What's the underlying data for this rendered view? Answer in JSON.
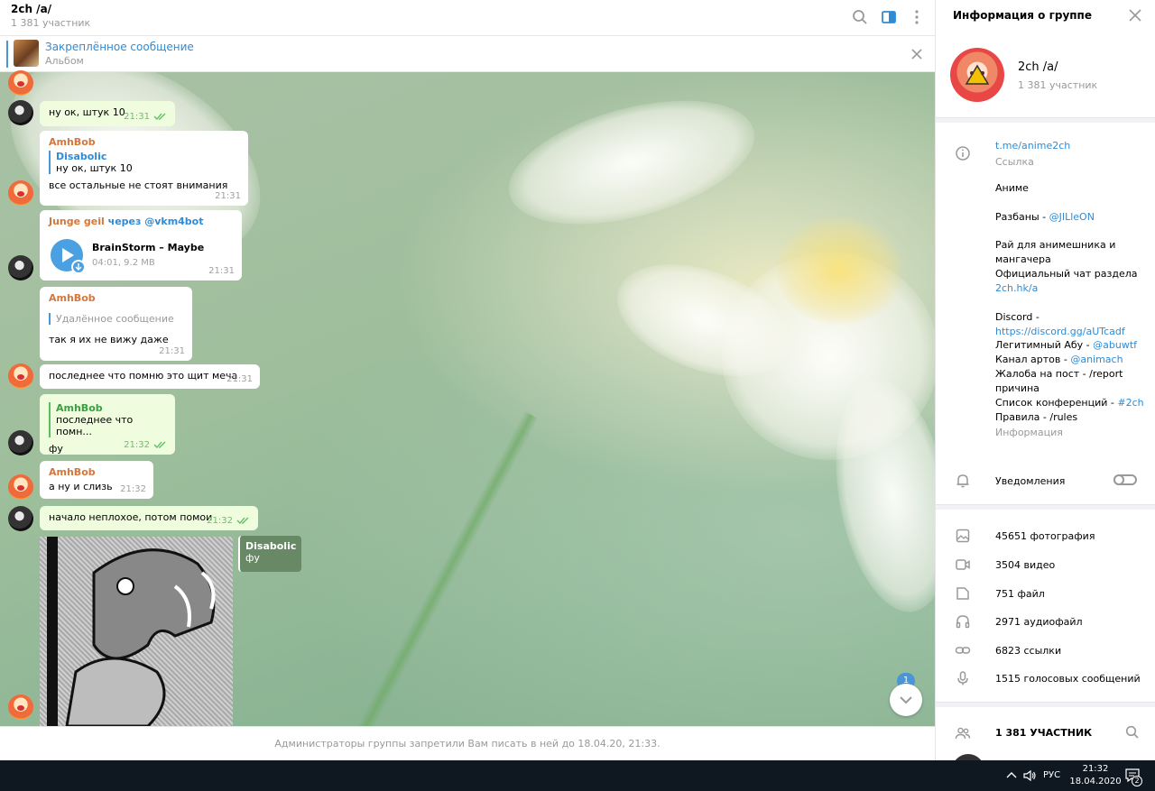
{
  "chat": {
    "title": "2ch /a/",
    "subtitle": "1 381 участник",
    "pinned_title": "Закреплённое сообщение",
    "pinned_subtitle": "Альбом",
    "composer_notice": "Администраторы группы запретили Вам писать в ней до 18.04.20, 21:33.",
    "unread_count": "1"
  },
  "messages": {
    "m1": {
      "text": "ну ок, штук 10",
      "time": "21:31"
    },
    "m2": {
      "sender": "AmhBob",
      "quote_name": "Disabolic",
      "quote_text": "ну ок, штук 10",
      "text": "все остальные не стоят внимания",
      "time": "21:31"
    },
    "m3": {
      "sender": "Junge geil",
      "via": "через @vkm4bot",
      "track": "BrainStorm – Maybe",
      "meta": "04:01, 9.2 MB",
      "time": "21:31"
    },
    "m4": {
      "sender": "AmhBob",
      "quote_text": "Удалённое сообщение",
      "text": "так я их не вижу даже",
      "time": "21:31"
    },
    "m5": {
      "text": "последнее что помню это щит меча",
      "time": "21:31"
    },
    "m6": {
      "quote_name": "AmhBob",
      "quote_text": "последнее что помн...",
      "text": "фу",
      "time": "21:32"
    },
    "m7": {
      "sender": "AmhBob",
      "text": "а ну и слизь",
      "time": "21:32"
    },
    "m8": {
      "text": "начало неплохое, потом помои",
      "time": "21:32"
    },
    "reply_card": {
      "name": "Disabolic",
      "text": "фу"
    }
  },
  "info": {
    "title": "Информация о группе",
    "group_name": "2ch /a/",
    "group_members": "1 381 участник",
    "link": "t.me/anime2ch",
    "link_label": "Ссылка",
    "description": {
      "l1": "Аниме",
      "l2_text": "Разбаны - ",
      "l2_link": "@JILleON",
      "l3": "Рай для анимешника и",
      "l4": "мангачера",
      "l5": "Официальный чат раздела",
      "l6_link": "2ch.hk/a",
      "l7": "Discord -",
      "l8_link": "https://discord.gg/aUTcadf",
      "l9_text": "Легитимный Абу - ",
      "l9_link": "@abuwtf",
      "l10_text": "Канал артов - ",
      "l10_link": "@animach",
      "l11": "Жалоба на пост - /report",
      "l12": "причина",
      "l13_text": "Список конференций - ",
      "l13_link": "#2ch",
      "l14": "Правила - /rules"
    },
    "description_label": "Информация",
    "notifications": "Уведомления",
    "media": {
      "photos": "45651 фотография",
      "videos": "3504 видео",
      "files": "751 файл",
      "audio": "2971 аудиофайл",
      "links": "6823 ссылки",
      "voice": "1515 голосовых сообщений"
    },
    "members_header": "1 381 УЧАСТНИК"
  },
  "taskbar": {
    "lang": "РУС",
    "time": "21:32",
    "date": "18.04.2020",
    "notif_count": "2"
  },
  "colors": {
    "accent": "#2f8bd6",
    "sender_orange": "#d8763a",
    "sender_green": "#37a141",
    "outgoing_bubble": "#effdde"
  }
}
